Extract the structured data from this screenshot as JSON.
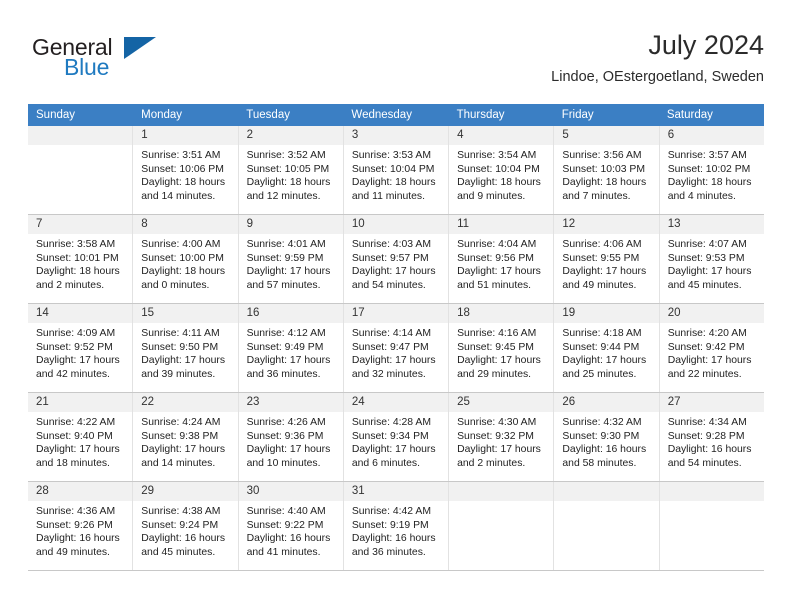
{
  "brand": {
    "name_top": "General",
    "name_bottom": "Blue",
    "color_dark": "#231f20",
    "color_blue": "#1f7ac0",
    "triangle_color": "#1464a5"
  },
  "header": {
    "title": "July 2024",
    "subtitle": "Lindoe, OEstergoetland, Sweden"
  },
  "calendar": {
    "header_bg": "#3b7fc4",
    "daynumber_bg": "#f1f1f1",
    "weekdays": [
      "Sunday",
      "Monday",
      "Tuesday",
      "Wednesday",
      "Thursday",
      "Friday",
      "Saturday"
    ],
    "weeks": [
      [
        {
          "day": "",
          "empty": true,
          "sunrise": "",
          "sunset": "",
          "daylight": ""
        },
        {
          "day": "1",
          "sunrise": "Sunrise: 3:51 AM",
          "sunset": "Sunset: 10:06 PM",
          "daylight": "Daylight: 18 hours and 14 minutes."
        },
        {
          "day": "2",
          "sunrise": "Sunrise: 3:52 AM",
          "sunset": "Sunset: 10:05 PM",
          "daylight": "Daylight: 18 hours and 12 minutes."
        },
        {
          "day": "3",
          "sunrise": "Sunrise: 3:53 AM",
          "sunset": "Sunset: 10:04 PM",
          "daylight": "Daylight: 18 hours and 11 minutes."
        },
        {
          "day": "4",
          "sunrise": "Sunrise: 3:54 AM",
          "sunset": "Sunset: 10:04 PM",
          "daylight": "Daylight: 18 hours and 9 minutes."
        },
        {
          "day": "5",
          "sunrise": "Sunrise: 3:56 AM",
          "sunset": "Sunset: 10:03 PM",
          "daylight": "Daylight: 18 hours and 7 minutes."
        },
        {
          "day": "6",
          "sunrise": "Sunrise: 3:57 AM",
          "sunset": "Sunset: 10:02 PM",
          "daylight": "Daylight: 18 hours and 4 minutes."
        }
      ],
      [
        {
          "day": "7",
          "sunrise": "Sunrise: 3:58 AM",
          "sunset": "Sunset: 10:01 PM",
          "daylight": "Daylight: 18 hours and 2 minutes."
        },
        {
          "day": "8",
          "sunrise": "Sunrise: 4:00 AM",
          "sunset": "Sunset: 10:00 PM",
          "daylight": "Daylight: 18 hours and 0 minutes."
        },
        {
          "day": "9",
          "sunrise": "Sunrise: 4:01 AM",
          "sunset": "Sunset: 9:59 PM",
          "daylight": "Daylight: 17 hours and 57 minutes."
        },
        {
          "day": "10",
          "sunrise": "Sunrise: 4:03 AM",
          "sunset": "Sunset: 9:57 PM",
          "daylight": "Daylight: 17 hours and 54 minutes."
        },
        {
          "day": "11",
          "sunrise": "Sunrise: 4:04 AM",
          "sunset": "Sunset: 9:56 PM",
          "daylight": "Daylight: 17 hours and 51 minutes."
        },
        {
          "day": "12",
          "sunrise": "Sunrise: 4:06 AM",
          "sunset": "Sunset: 9:55 PM",
          "daylight": "Daylight: 17 hours and 49 minutes."
        },
        {
          "day": "13",
          "sunrise": "Sunrise: 4:07 AM",
          "sunset": "Sunset: 9:53 PM",
          "daylight": "Daylight: 17 hours and 45 minutes."
        }
      ],
      [
        {
          "day": "14",
          "sunrise": "Sunrise: 4:09 AM",
          "sunset": "Sunset: 9:52 PM",
          "daylight": "Daylight: 17 hours and 42 minutes."
        },
        {
          "day": "15",
          "sunrise": "Sunrise: 4:11 AM",
          "sunset": "Sunset: 9:50 PM",
          "daylight": "Daylight: 17 hours and 39 minutes."
        },
        {
          "day": "16",
          "sunrise": "Sunrise: 4:12 AM",
          "sunset": "Sunset: 9:49 PM",
          "daylight": "Daylight: 17 hours and 36 minutes."
        },
        {
          "day": "17",
          "sunrise": "Sunrise: 4:14 AM",
          "sunset": "Sunset: 9:47 PM",
          "daylight": "Daylight: 17 hours and 32 minutes."
        },
        {
          "day": "18",
          "sunrise": "Sunrise: 4:16 AM",
          "sunset": "Sunset: 9:45 PM",
          "daylight": "Daylight: 17 hours and 29 minutes."
        },
        {
          "day": "19",
          "sunrise": "Sunrise: 4:18 AM",
          "sunset": "Sunset: 9:44 PM",
          "daylight": "Daylight: 17 hours and 25 minutes."
        },
        {
          "day": "20",
          "sunrise": "Sunrise: 4:20 AM",
          "sunset": "Sunset: 9:42 PM",
          "daylight": "Daylight: 17 hours and 22 minutes."
        }
      ],
      [
        {
          "day": "21",
          "sunrise": "Sunrise: 4:22 AM",
          "sunset": "Sunset: 9:40 PM",
          "daylight": "Daylight: 17 hours and 18 minutes."
        },
        {
          "day": "22",
          "sunrise": "Sunrise: 4:24 AM",
          "sunset": "Sunset: 9:38 PM",
          "daylight": "Daylight: 17 hours and 14 minutes."
        },
        {
          "day": "23",
          "sunrise": "Sunrise: 4:26 AM",
          "sunset": "Sunset: 9:36 PM",
          "daylight": "Daylight: 17 hours and 10 minutes."
        },
        {
          "day": "24",
          "sunrise": "Sunrise: 4:28 AM",
          "sunset": "Sunset: 9:34 PM",
          "daylight": "Daylight: 17 hours and 6 minutes."
        },
        {
          "day": "25",
          "sunrise": "Sunrise: 4:30 AM",
          "sunset": "Sunset: 9:32 PM",
          "daylight": "Daylight: 17 hours and 2 minutes."
        },
        {
          "day": "26",
          "sunrise": "Sunrise: 4:32 AM",
          "sunset": "Sunset: 9:30 PM",
          "daylight": "Daylight: 16 hours and 58 minutes."
        },
        {
          "day": "27",
          "sunrise": "Sunrise: 4:34 AM",
          "sunset": "Sunset: 9:28 PM",
          "daylight": "Daylight: 16 hours and 54 minutes."
        }
      ],
      [
        {
          "day": "28",
          "sunrise": "Sunrise: 4:36 AM",
          "sunset": "Sunset: 9:26 PM",
          "daylight": "Daylight: 16 hours and 49 minutes."
        },
        {
          "day": "29",
          "sunrise": "Sunrise: 4:38 AM",
          "sunset": "Sunset: 9:24 PM",
          "daylight": "Daylight: 16 hours and 45 minutes."
        },
        {
          "day": "30",
          "sunrise": "Sunrise: 4:40 AM",
          "sunset": "Sunset: 9:22 PM",
          "daylight": "Daylight: 16 hours and 41 minutes."
        },
        {
          "day": "31",
          "sunrise": "Sunrise: 4:42 AM",
          "sunset": "Sunset: 9:19 PM",
          "daylight": "Daylight: 16 hours and 36 minutes."
        },
        {
          "day": "",
          "empty": true,
          "sunrise": "",
          "sunset": "",
          "daylight": ""
        },
        {
          "day": "",
          "empty": true,
          "sunrise": "",
          "sunset": "",
          "daylight": ""
        },
        {
          "day": "",
          "empty": true,
          "sunrise": "",
          "sunset": "",
          "daylight": ""
        }
      ]
    ]
  }
}
